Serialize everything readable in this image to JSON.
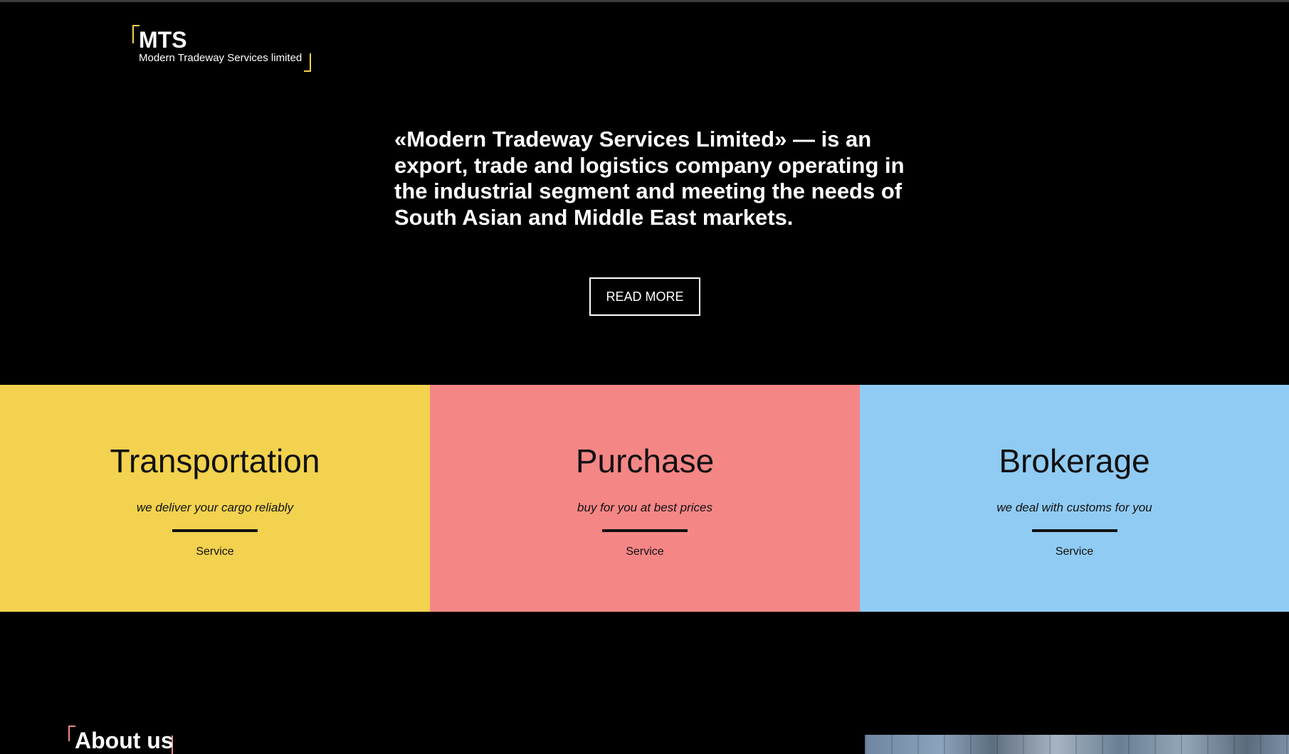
{
  "logo": {
    "title": "MTS",
    "subtitle": "Modern Tradeway Services limited"
  },
  "hero": {
    "text": "«Modern Tradeway Services Limited» — is an export, trade and logistics company operating in the industrial segment and meeting the needs of South Asian and Middle East markets.",
    "button_label": "READ MORE"
  },
  "services": [
    {
      "title": "Transportation",
      "description": "we deliver your cargo reliably",
      "link": "Service",
      "color": "#f2d24e"
    },
    {
      "title": "Purchase",
      "description": "buy for you at best prices",
      "link": "Service",
      "color": "#f58686"
    },
    {
      "title": "Brokerage",
      "description": "we deal with customs for you",
      "link": "Service",
      "color": "#90cbf3"
    }
  ],
  "about": {
    "title": "About us"
  },
  "colors": {
    "background": "#000000",
    "accent_yellow": "#f2d04e",
    "accent_pink": "#f08a8a"
  }
}
